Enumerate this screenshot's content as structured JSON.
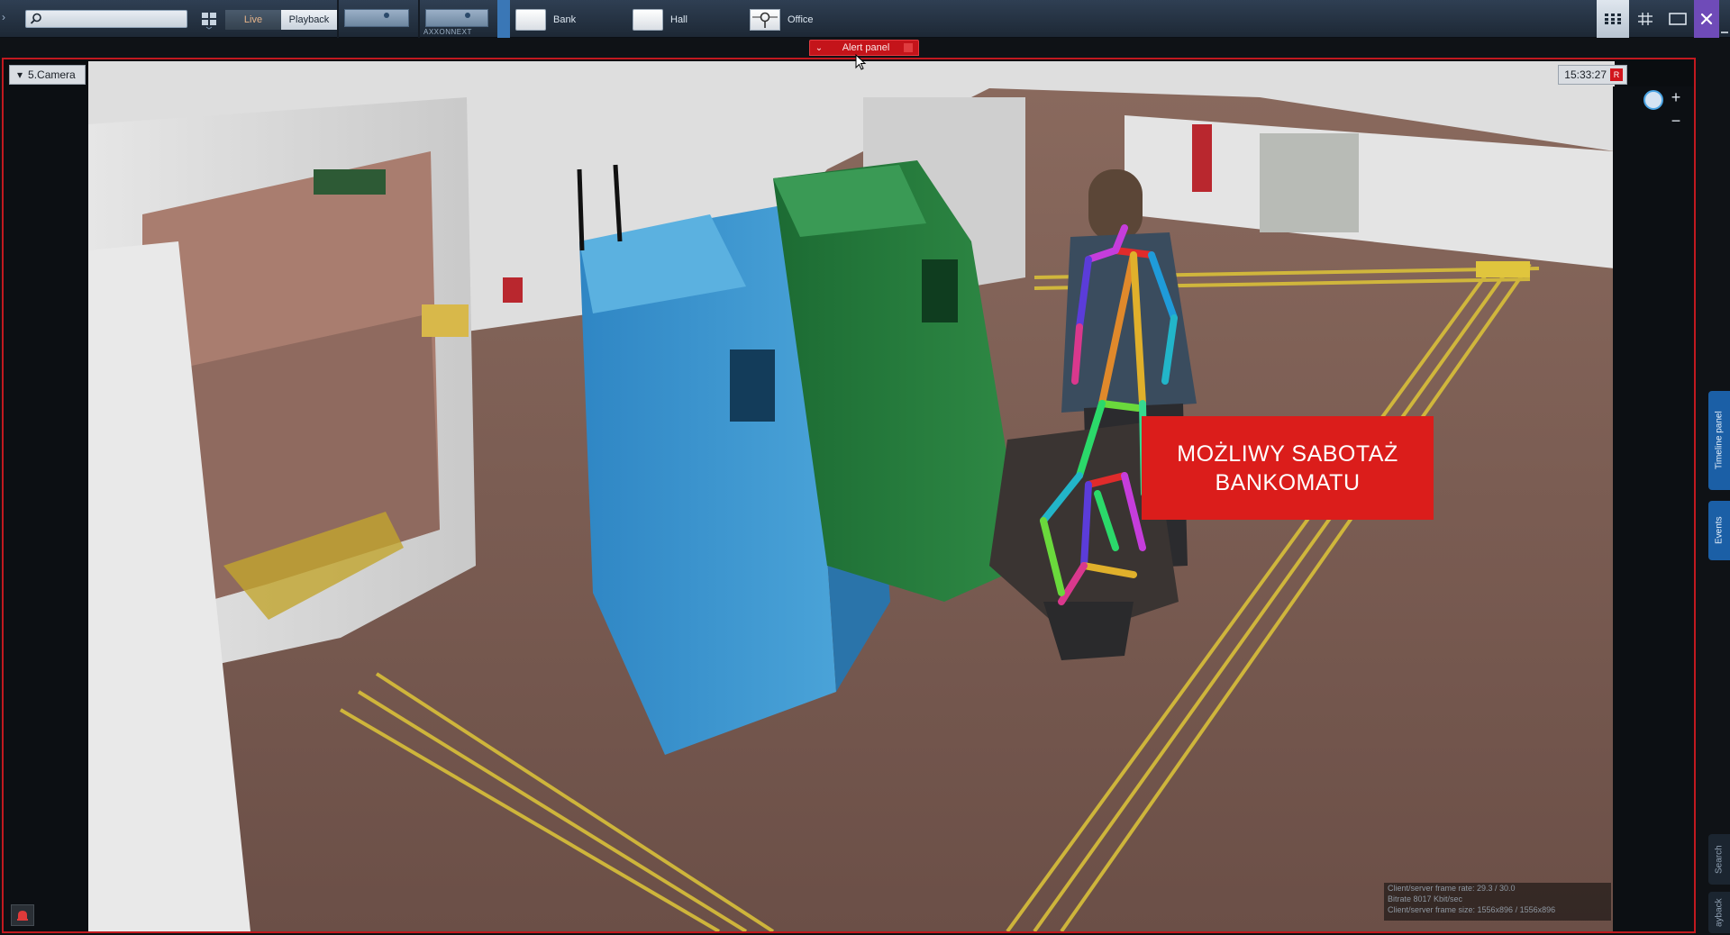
{
  "toolbar": {
    "search": {
      "value": "",
      "placeholder": ""
    },
    "modes": {
      "live": "Live",
      "playback": "Playback"
    },
    "thumb_label": "AXXONNEXT",
    "layouts": [
      {
        "label": "Bank"
      },
      {
        "label": "Hall"
      },
      {
        "label": "Office"
      }
    ]
  },
  "alert_panel": {
    "label": "Alert panel"
  },
  "camera": {
    "name": "5.Camera",
    "time": "15:33:27",
    "rec_badge": "R"
  },
  "overlay": {
    "line1": "MOŻLIWY SABOTAŻ",
    "line2": "BANKOMATU",
    "color": "#db1d1b"
  },
  "side_panel": {
    "timeline_tab": "Timeline panel",
    "events_tab": "Events",
    "search_tab": "Search",
    "playback_tab": "ayback"
  },
  "stats": {
    "frame_rate": "Client/server frame rate: 29.3 / 30.0",
    "bitrate": "Bitrate 8017 Kbit/sec",
    "frame_size": "Client/server frame size: 1556x896 / 1556x896"
  },
  "colors": {
    "accent_red": "#c1191f",
    "toolbar": "#25303e",
    "side_tab_blue": "#1b5fa6",
    "window_button_purple": "#6f4bb8"
  }
}
